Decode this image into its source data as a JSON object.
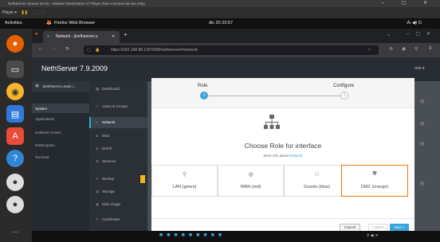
{
  "vm": {
    "title": "NethServer Ubuntu 64-bit - VMware Workstation 17 Player (Non-commercial use only)",
    "player_label": "Player ▾",
    "controls": "–  ▢  ✕"
  },
  "topbar": {
    "activities": "Activities",
    "app_name": "Firefox Web Browser",
    "clock": "dic 20 23:57",
    "status_icons": "⁂ ◀) ⏻"
  },
  "browser": {
    "tab_title": "Network - jlnethserver.u",
    "url": "https://192.168.88.129:9090/nethserver#/network",
    "url_host": "192.168.88.129"
  },
  "neth": {
    "brand": "NethServer 7.9.2009",
    "user": "root ▾",
    "host_item": "jlnethserver.unad.c...",
    "nav_primary": [
      {
        "label": "System",
        "active": true
      },
      {
        "label": "Applications",
        "active": false
      },
      {
        "label": "Software Center",
        "active": false
      },
      {
        "label": "Subscription",
        "active": false
      },
      {
        "label": "Terminal",
        "active": false
      }
    ],
    "nav_secondary": [
      {
        "icon": "▦",
        "label": "Dashboard",
        "active": false
      },
      {
        "icon": "⚇",
        "label": "Users & Groups",
        "active": false
      },
      {
        "icon": "⑆",
        "label": "Network",
        "active": true
      },
      {
        "icon": "≣",
        "label": "DNS",
        "active": false
      },
      {
        "icon": "≣",
        "label": "DHCP",
        "active": false
      },
      {
        "icon": "⚙",
        "label": "Services",
        "active": false
      },
      {
        "icon": "↻",
        "label": "Backup",
        "active": false
      },
      {
        "icon": "▤",
        "label": "Storage",
        "active": false
      },
      {
        "icon": "◉",
        "label": "Disk Usage",
        "active": false
      },
      {
        "icon": "✎",
        "label": "Certificates",
        "active": false
      }
    ]
  },
  "wizard": {
    "step1": "Role",
    "step2": "Configure",
    "step1_num": "1",
    "step2_num": "2",
    "heading": "Choose Role for interface",
    "more_info": "More info about",
    "more_info_link": "Network",
    "roles": [
      {
        "icon": "⚲",
        "label": "LAN (green)",
        "selected": false
      },
      {
        "icon": "◍",
        "label": "WAN (red)",
        "selected": false
      },
      {
        "icon": "⚇",
        "label": "Guests (blue)",
        "selected": false
      },
      {
        "icon": "⛊",
        "label": "DMZ (orange)",
        "selected": true
      }
    ],
    "cancel": "Cancel",
    "back": "< Back",
    "next": "Next >"
  },
  "colors": {
    "accent": "#39a5dc",
    "selected_border": "#ec7a08",
    "pause": "#f2b31b"
  }
}
